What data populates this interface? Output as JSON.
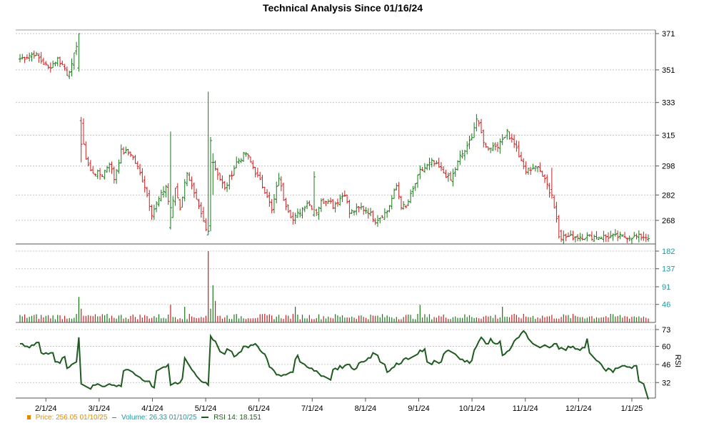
{
  "chart_data": {
    "type": "ohlc",
    "title": "Technical Analysis Since 01/16/24",
    "colors": {
      "up": "#1a7a1a",
      "down": "#cc2020",
      "volume_axis": "#1a9aa0",
      "rsi": "#1e5b1e",
      "price_legend": "#e08a00",
      "grid": "#bbbbbb"
    },
    "x_tick_labels": [
      "2/1/24",
      "3/1/24",
      "4/1/24",
      "5/1/24",
      "6/1/24",
      "7/1/24",
      "8/1/24",
      "9/1/24",
      "10/1/24",
      "11/1/24",
      "12/1/24",
      "1/1/25"
    ],
    "price_panel": {
      "yticks": [
        371,
        351,
        333,
        315,
        298,
        282,
        268
      ],
      "ylim": [
        255,
        373
      ],
      "keypoints": [
        [
          0,
          357
        ],
        [
          6,
          360
        ],
        [
          12,
          352
        ],
        [
          16,
          357
        ],
        [
          19,
          352
        ],
        [
          20,
          349
        ],
        [
          22,
          353
        ],
        [
          25,
          371
        ],
        [
          26,
          320
        ],
        [
          28,
          302
        ],
        [
          30,
          295
        ],
        [
          35,
          293
        ],
        [
          38,
          300
        ],
        [
          40,
          291
        ],
        [
          43,
          306
        ],
        [
          47,
          305
        ],
        [
          50,
          297
        ],
        [
          53,
          287
        ],
        [
          56,
          272
        ],
        [
          62,
          287
        ],
        [
          64,
          270
        ],
        [
          66,
          286
        ],
        [
          68,
          275
        ],
        [
          71,
          295
        ],
        [
          74,
          282
        ],
        [
          78,
          267
        ],
        [
          80,
          258
        ],
        [
          81,
          278
        ],
        [
          82,
          300
        ],
        [
          85,
          291
        ],
        [
          87,
          285
        ],
        [
          92,
          300
        ],
        [
          96,
          305
        ],
        [
          98,
          300
        ],
        [
          101,
          292
        ],
        [
          105,
          282
        ],
        [
          107,
          273
        ],
        [
          110,
          292
        ],
        [
          112,
          280
        ],
        [
          116,
          268
        ],
        [
          122,
          278
        ],
        [
          126,
          273
        ],
        [
          128,
          278
        ],
        [
          131,
          280
        ],
        [
          133,
          276
        ],
        [
          138,
          283
        ],
        [
          140,
          272
        ],
        [
          145,
          275
        ],
        [
          148,
          273
        ],
        [
          151,
          268
        ],
        [
          156,
          273
        ],
        [
          160,
          287
        ],
        [
          162,
          276
        ],
        [
          164,
          275
        ],
        [
          170,
          295
        ],
        [
          175,
          300
        ],
        [
          179,
          296
        ],
        [
          183,
          290
        ],
        [
          187,
          303
        ],
        [
          190,
          308
        ],
        [
          192,
          315
        ],
        [
          194,
          324
        ],
        [
          198,
          308
        ],
        [
          204,
          310
        ],
        [
          207,
          318
        ],
        [
          208,
          314
        ],
        [
          210,
          311
        ],
        [
          213,
          300
        ],
        [
          215,
          295
        ],
        [
          219,
          298
        ],
        [
          223,
          292
        ],
        [
          226,
          280
        ],
        [
          230,
          259
        ]
      ],
      "big_candles": [
        {
          "i": 25,
          "o": 352,
          "h": 371,
          "l": 350,
          "c": 371
        },
        {
          "i": 26,
          "o": 323,
          "h": 325,
          "l": 300,
          "c": 310
        },
        {
          "i": 64,
          "o": 264,
          "h": 317,
          "l": 263,
          "c": 275
        },
        {
          "i": 80,
          "o": 260,
          "h": 339,
          "l": 260,
          "c": 262
        },
        {
          "i": 81,
          "o": 265,
          "h": 314,
          "l": 262,
          "c": 312
        },
        {
          "i": 82,
          "o": 300,
          "h": 305,
          "l": 282,
          "c": 300
        },
        {
          "i": 125,
          "o": 271,
          "h": 295,
          "l": 270,
          "c": 292
        },
        {
          "i": 226,
          "o": 285,
          "h": 297,
          "l": 280,
          "c": 282
        },
        {
          "i": 229,
          "o": 270,
          "h": 271,
          "l": 258,
          "c": 259
        }
      ]
    },
    "volume_panel": {
      "yticks": [
        182,
        137,
        91,
        46
      ],
      "ylim": [
        0,
        182
      ],
      "spikes": [
        [
          25,
          65
        ],
        [
          26,
          35
        ],
        [
          64,
          45
        ],
        [
          70,
          40
        ],
        [
          80,
          182
        ],
        [
          81,
          35
        ],
        [
          82,
          95
        ],
        [
          83,
          55
        ],
        [
          117,
          40
        ],
        [
          170,
          45
        ],
        [
          205,
          40
        ]
      ]
    },
    "rsi_panel": {
      "yticks": [
        73,
        60,
        46,
        32
      ],
      "ylim": [
        20,
        73
      ],
      "axis_label": "RSI",
      "values": [
        62,
        62,
        60,
        60,
        59,
        61,
        61,
        63,
        63,
        55,
        54,
        55,
        54,
        55,
        55,
        48,
        48,
        47,
        51,
        52,
        43,
        44,
        46,
        47,
        48,
        67,
        31,
        30,
        29,
        28,
        27,
        30,
        30,
        31,
        30,
        29,
        29,
        30,
        31,
        30,
        30,
        29,
        30,
        29,
        41,
        42,
        42,
        41,
        40,
        38,
        37,
        36,
        34,
        33,
        33,
        33,
        29,
        28,
        41,
        42,
        43,
        44,
        44,
        46,
        30,
        31,
        32,
        31,
        32,
        35,
        51,
        48,
        45,
        42,
        40,
        37,
        35,
        33,
        32,
        32,
        30,
        68,
        65,
        64,
        60,
        56,
        55,
        54,
        58,
        57,
        56,
        52,
        53,
        55,
        56,
        60,
        60,
        59,
        61,
        61,
        62,
        60,
        57,
        55,
        54,
        50,
        44,
        43,
        41,
        38,
        38,
        37,
        38,
        38,
        39,
        40,
        40,
        50,
        53,
        48,
        47,
        46,
        44,
        43,
        43,
        41,
        41,
        39,
        37,
        37,
        36,
        35,
        34,
        42,
        43,
        42,
        45,
        43,
        45,
        46,
        46,
        43,
        42,
        43,
        47,
        48,
        48,
        49,
        51,
        51,
        55,
        54,
        53,
        48,
        47,
        46,
        40,
        41,
        43,
        44,
        47,
        46,
        47,
        50,
        51,
        50,
        51,
        52,
        53,
        54,
        57,
        56,
        58,
        48,
        47,
        46,
        49,
        48,
        47,
        48,
        54,
        56,
        57,
        56,
        55,
        54,
        52,
        50,
        50,
        48,
        49,
        47,
        49,
        57,
        60,
        64,
        67,
        65,
        62,
        62,
        66,
        63,
        62,
        62,
        64,
        53,
        54,
        56,
        57,
        60,
        64,
        66,
        67,
        70,
        72,
        70,
        66,
        64,
        62,
        61,
        60,
        59,
        60,
        61,
        60,
        59,
        60,
        62,
        62,
        58,
        59,
        58,
        57,
        60,
        59,
        60,
        58,
        58,
        57,
        59,
        59,
        66,
        55,
        53,
        51,
        49,
        48,
        46,
        43,
        41,
        43,
        42,
        40,
        43,
        43,
        44,
        45,
        45,
        44,
        44,
        43,
        45,
        45,
        33,
        32,
        31,
        25,
        19
      ]
    }
  },
  "legend": {
    "price": "Price: 256.05  01/10/25",
    "volume": "Volume: 26.33  01/10/25",
    "rsi": "RSI 14: 18.151"
  }
}
